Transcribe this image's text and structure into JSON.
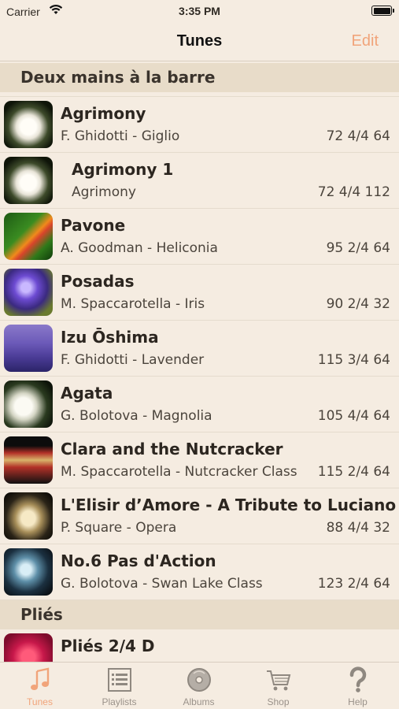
{
  "status_bar": {
    "carrier": "Carrier",
    "time": "3:35 PM"
  },
  "nav": {
    "title": "Tunes",
    "edit_label": "Edit"
  },
  "sections": [
    {
      "header": "Deux mains à la barre",
      "rows": [
        {
          "title": "Agrimony",
          "subtitle": "F. Ghidotti - Giglio",
          "meta": "72 4/4 64",
          "thumb": "lily"
        },
        {
          "title": "Agrimony 1",
          "subtitle": "Agrimony",
          "meta": "72 4/4 112",
          "thumb": "lily"
        },
        {
          "title": "Pavone",
          "subtitle": "A. Goodman - Heliconia",
          "meta": "95 2/4 64",
          "thumb": "bird-of-paradise"
        },
        {
          "title": "Posadas",
          "subtitle": "M. Spaccarotella - Iris",
          "meta": "90 2/4 32",
          "thumb": "iris"
        },
        {
          "title": "Izu Ōshima",
          "subtitle": "F. Ghidotti - Lavender",
          "meta": "115 3/4 64",
          "thumb": "lavender"
        },
        {
          "title": "Agata",
          "subtitle": "G. Bolotova - Magnolia",
          "meta": "105 4/4 64",
          "thumb": "magnolia"
        },
        {
          "title": "Clara and the Nutcracker",
          "subtitle": "M. Spaccarotella - Nutcracker Class",
          "meta": "115 2/4 64",
          "thumb": "nutcracker"
        },
        {
          "title": "L'Elisir d’Amore - A Tribute to Luciano",
          "subtitle": "P. Square - Opera",
          "meta": "88 4/4 32",
          "thumb": "opera-house"
        },
        {
          "title": "No.6 Pas d'Action",
          "subtitle": "G. Bolotova - Swan Lake Class",
          "meta": "123 2/4 64",
          "thumb": "swan-lake"
        }
      ]
    },
    {
      "header": "Pliés",
      "rows": [
        {
          "title": "Pliés 2/4 D",
          "thumb": "red-flowers"
        }
      ]
    }
  ],
  "tabs": [
    {
      "label": "Tunes",
      "icon": "music-note-icon",
      "active": true
    },
    {
      "label": "Playlists",
      "icon": "list-icon",
      "active": false
    },
    {
      "label": "Albums",
      "icon": "album-icon",
      "active": false
    },
    {
      "label": "Shop",
      "icon": "cart-icon",
      "active": false
    },
    {
      "label": "Help",
      "icon": "question-icon",
      "active": false
    }
  ],
  "colors": {
    "accent": "#f1a47a",
    "background": "#f5ece1",
    "section_header": "#e8dcc9",
    "tab_inactive": "#9a928a"
  }
}
